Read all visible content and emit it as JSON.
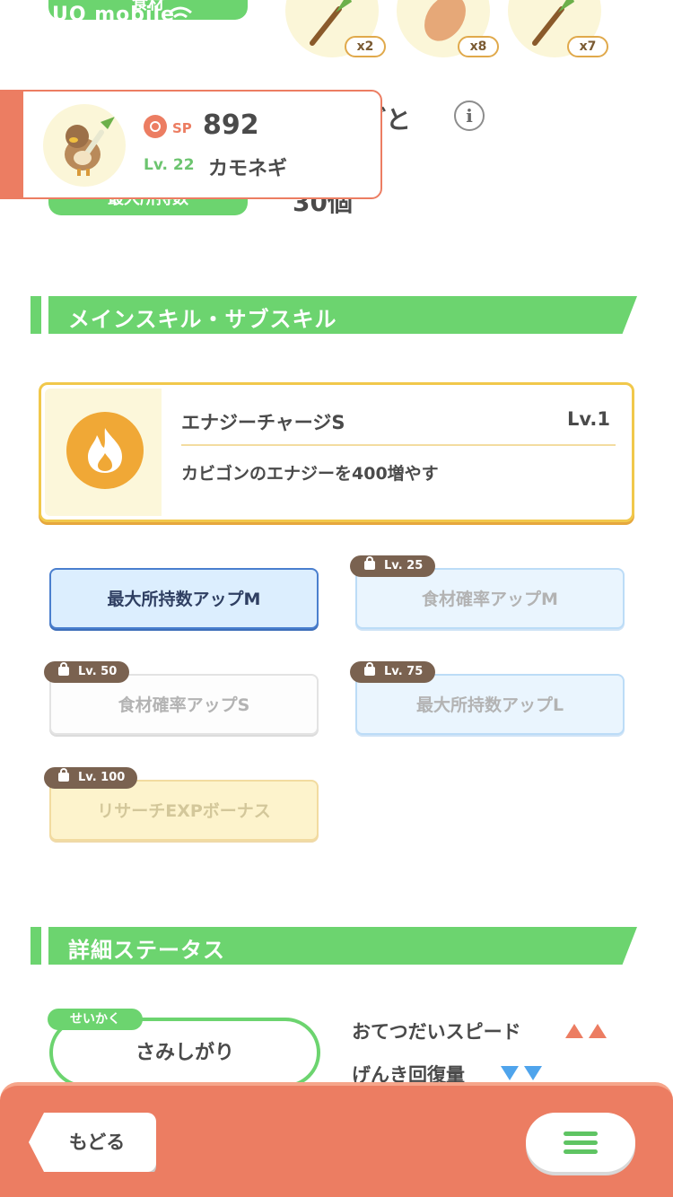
{
  "status_bar": {
    "carrier": "UQ mobile"
  },
  "top_partial": {
    "ingredient_label": "食材",
    "ingredients": [
      {
        "icon": "leek-icon",
        "count": "x2"
      },
      {
        "icon": "bread-icon",
        "count": "x8"
      },
      {
        "icon": "leek-icon",
        "count": "x7"
      }
    ],
    "heading_tail": "ごと",
    "carry_label": "最大所持数",
    "carry_value": "30個"
  },
  "pokemon_card": {
    "sp_label": "SP",
    "sp_value": "892",
    "level": "Lv. 22",
    "name": "カモネギ"
  },
  "skills_section": {
    "title": "メインスキル・サブスキル",
    "main_skill": {
      "name": "エナジーチャージS",
      "level": "Lv.1",
      "description": "カビゴンのエナジーを400増やす",
      "icon": "fire-icon"
    },
    "sub_skills": [
      {
        "label": "最大所持数アップM",
        "lock": ""
      },
      {
        "label": "食材確率アップM",
        "lock": "Lv. 25"
      },
      {
        "label": "食材確率アップS",
        "lock": "Lv. 50"
      },
      {
        "label": "最大所持数アップL",
        "lock": "Lv. 75"
      },
      {
        "label": "リサーチEXPボーナス",
        "lock": "Lv. 100"
      }
    ]
  },
  "status_section": {
    "title": "詳細ステータス",
    "nature_tag": "せいかく",
    "nature": "さみしがり",
    "up_effect": "おてつだいスピード",
    "down_effect": "げんき回復量"
  },
  "bottom_bar": {
    "back_label": "もどる",
    "menu_icon": "hamburger-menu-icon"
  },
  "colors": {
    "accent_green": "#6cd46f",
    "accent_orange": "#ec7d62",
    "gold": "#f1c84b",
    "up_arrow": "#ec7d62",
    "down_arrow": "#4fa4ec"
  }
}
